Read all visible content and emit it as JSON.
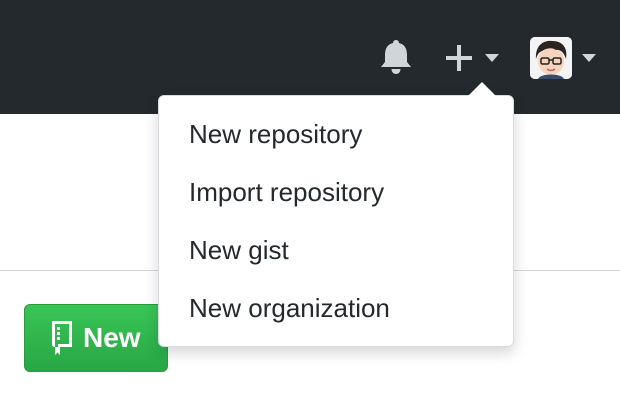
{
  "header": {
    "notifications_icon": "bell-icon",
    "create_menu_icon": "plus-icon",
    "create_caret_icon": "chevron-down-icon",
    "avatar_icon": "avatar",
    "avatar_caret_icon": "chevron-down-icon",
    "background": "#24292e"
  },
  "create_menu": {
    "items": [
      {
        "label": "New repository"
      },
      {
        "label": "Import repository"
      },
      {
        "label": "New gist"
      },
      {
        "label": "New organization"
      }
    ]
  },
  "main": {
    "new_button": {
      "label": "New",
      "icon": "repo-book-icon",
      "color": "#28a745"
    }
  }
}
